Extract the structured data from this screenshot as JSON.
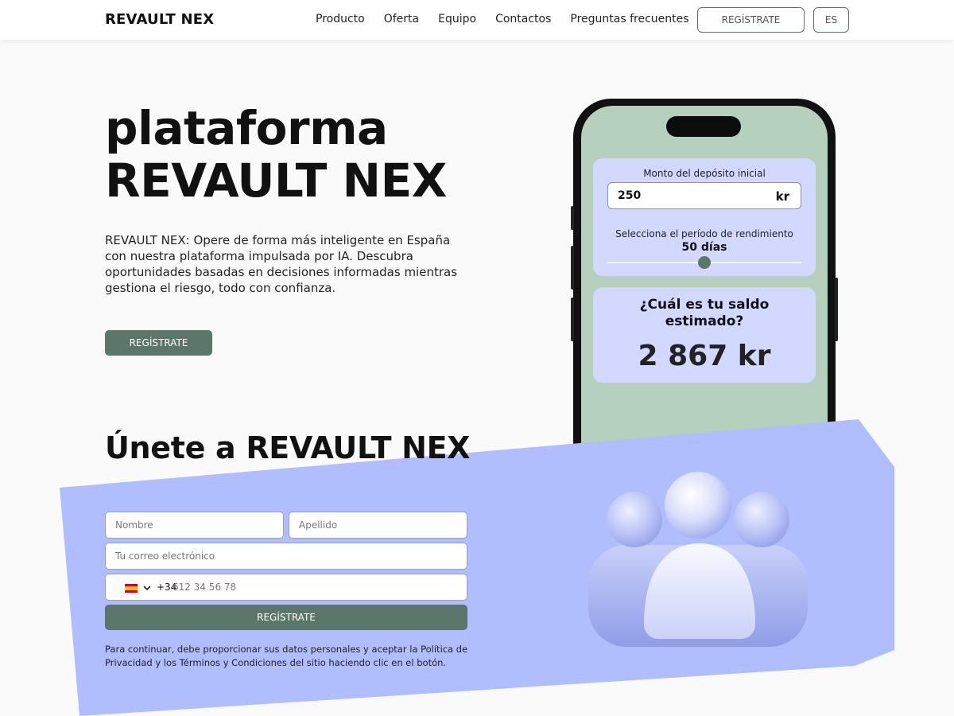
{
  "header": {
    "logo": "REVAULT NEX",
    "nav": [
      "Producto",
      "Oferta",
      "Equipo",
      "Contactos",
      "Preguntas frecuentes"
    ],
    "register_label": "REGÍSTRATE",
    "lang_label": "ES"
  },
  "hero": {
    "title_line1": "plataforma",
    "title_line2": "REVAULT NEX",
    "description": "REVAULT NEX: Opere de forma más inteligente en España con nuestra plataforma impulsada por IA. Descubra oportunidades basadas en decisiones informadas mientras gestiona el riesgo, todo con confianza.",
    "cta_label": "REGÍSTRATE"
  },
  "calculator": {
    "deposit_label": "Monto del depósito inicial",
    "deposit_value": "250",
    "currency": "kr",
    "period_label": "Selecciona el período de rendimiento",
    "period_value": "50 días",
    "slider_fraction": 0.5,
    "result_question": "¿Cuál es tu saldo estimado?",
    "result_value": "2 867 kr"
  },
  "join": {
    "title": "Únete a REVAULT NEX",
    "first_name_placeholder": "Nombre",
    "last_name_placeholder": "Apellido",
    "email_placeholder": "Tu correo electrónico",
    "dial_code": "+34",
    "phone_placeholder": "612 34 56 78",
    "flag_icon": "spain-flag-icon",
    "submit_label": "REGÍSTRATE",
    "consent": "Para continuar, debe proporcionar sus datos personales y aceptar la Política de Privacidad y los Términos y Condiciones del sitio haciendo clic en el botón."
  },
  "colors": {
    "accent": "#5d766c",
    "phone_screen": "#b5d0bd",
    "card": "#d2d8ff",
    "join_bg": "#b0bdff"
  }
}
